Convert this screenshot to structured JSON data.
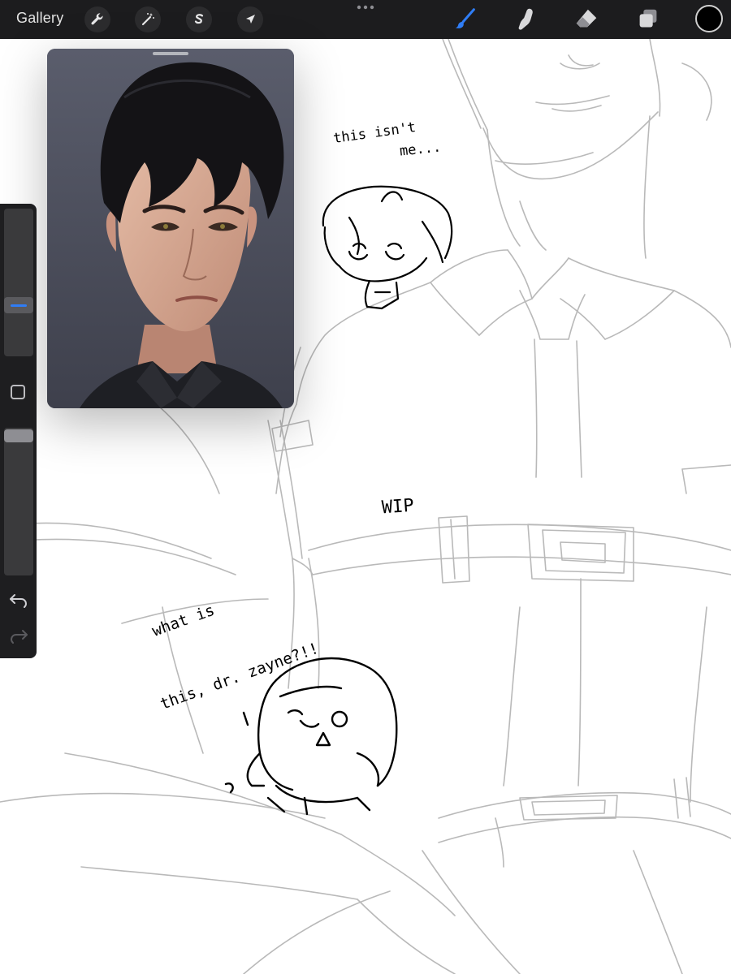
{
  "toolbar": {
    "gallery_label": "Gallery",
    "left_tools": [
      {
        "name": "actions",
        "icon": "wrench-icon"
      },
      {
        "name": "adjustments",
        "icon": "magic-wand-icon"
      },
      {
        "name": "selection",
        "icon": "selection-s-icon"
      },
      {
        "name": "transform",
        "icon": "arrow-cursor-icon"
      }
    ],
    "more_icon": "more-dots-icon",
    "right_tools": [
      {
        "name": "brush",
        "icon": "brush-icon",
        "active": true
      },
      {
        "name": "smudge",
        "icon": "smudge-finger-icon",
        "active": false
      },
      {
        "name": "eraser",
        "icon": "eraser-icon",
        "active": false
      },
      {
        "name": "layers",
        "icon": "layers-icon",
        "active": false
      }
    ],
    "current_color": "#000000",
    "accent_color": "#2f7df6"
  },
  "sidebar": {
    "size_slider_value": 0.67,
    "opacity_slider_value": 0.96,
    "modify_icon": "square-modify-icon",
    "undo_icon": "undo-icon",
    "redo_icon": "redo-icon"
  },
  "reference_window": {
    "subject": "portrait of dark-haired man in black collared shirt"
  },
  "canvas_notes": {
    "note1_line1": "this isn't",
    "note1_line2": "me...",
    "note2": "WIP",
    "note3_line1": "what is",
    "note3_line2": "this, dr. zayne?!!"
  }
}
